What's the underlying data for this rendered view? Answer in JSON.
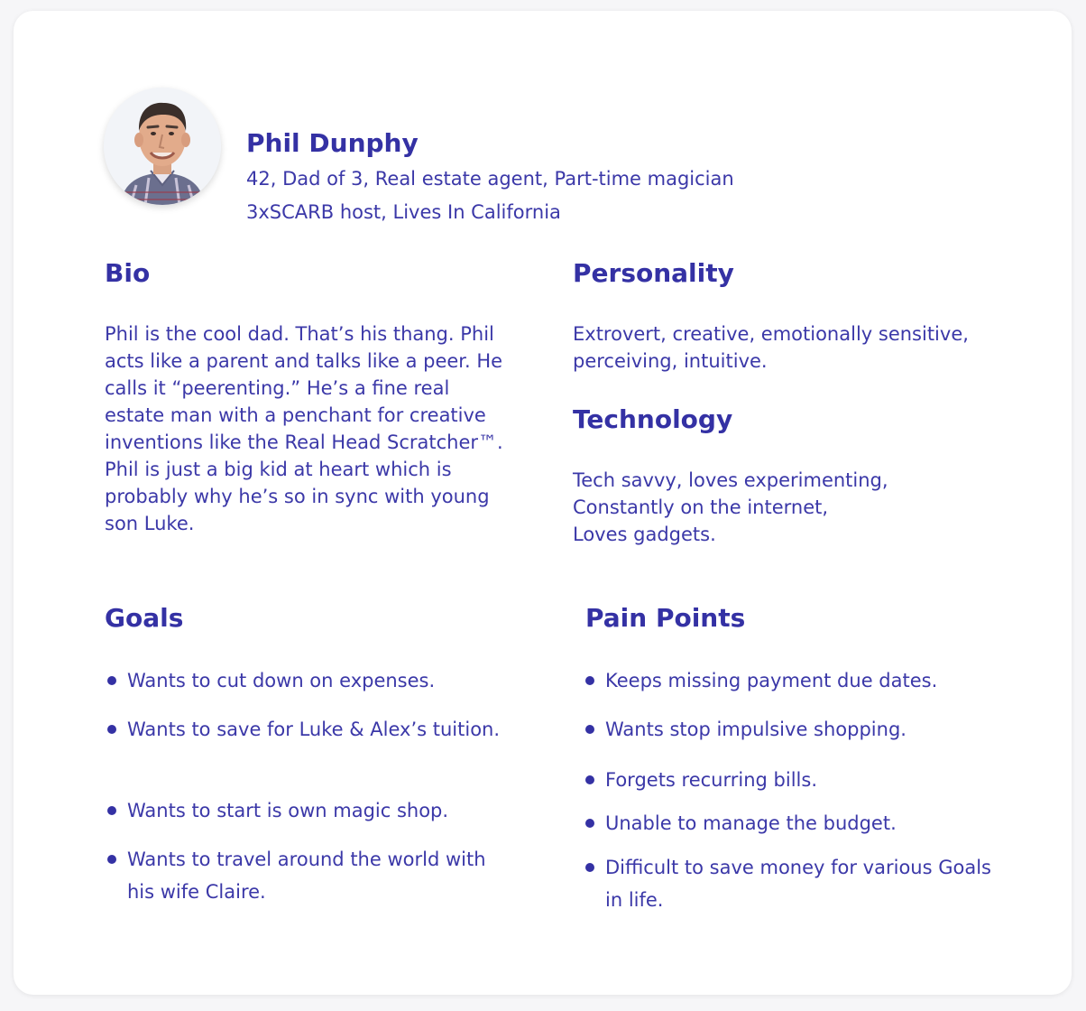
{
  "persona": {
    "name": "Phil Dunphy",
    "subtitle_line1": "42, Dad of 3, Real estate agent, Part-time magician",
    "subtitle_line2": "3xSCARB host, Lives In California"
  },
  "bio": {
    "heading": "Bio",
    "text": "Phil is the cool dad. That’s his thang. Phil acts like a parent and talks like a peer. He calls it “peerenting.” He’s a fine real estate man with a penchant for creative inventions like the Real Head Scratcher™. Phil is just a big kid at heart which is probably why he’s so in sync with young son Luke."
  },
  "personality": {
    "heading": "Personality",
    "text": "Extrovert, creative, emotionally sensitive, perceiving, intuitive."
  },
  "technology": {
    "heading": "Technology",
    "lines": [
      "Tech savvy, loves experimenting,",
      "Constantly on the internet,",
      "Loves gadgets."
    ]
  },
  "goals": {
    "heading": "Goals",
    "items": [
      "Wants to cut down on expenses.",
      "Wants to save for Luke & Alex’s tuition.",
      "Wants to start is own magic shop.",
      "Wants to travel around the world with his wife Claire."
    ]
  },
  "pain_points": {
    "heading": "Pain Points",
    "items": [
      "Keeps missing payment due dates.",
      "Wants stop impulsive shopping.",
      "Forgets recurring bills.",
      "Unable to manage the budget.",
      "Difficult to save money for various Goals in life."
    ]
  },
  "colors": {
    "accent": "#3431a4",
    "text": "#3b38a8",
    "card_background": "#ffffff",
    "page_background": "#f6f6f8"
  }
}
